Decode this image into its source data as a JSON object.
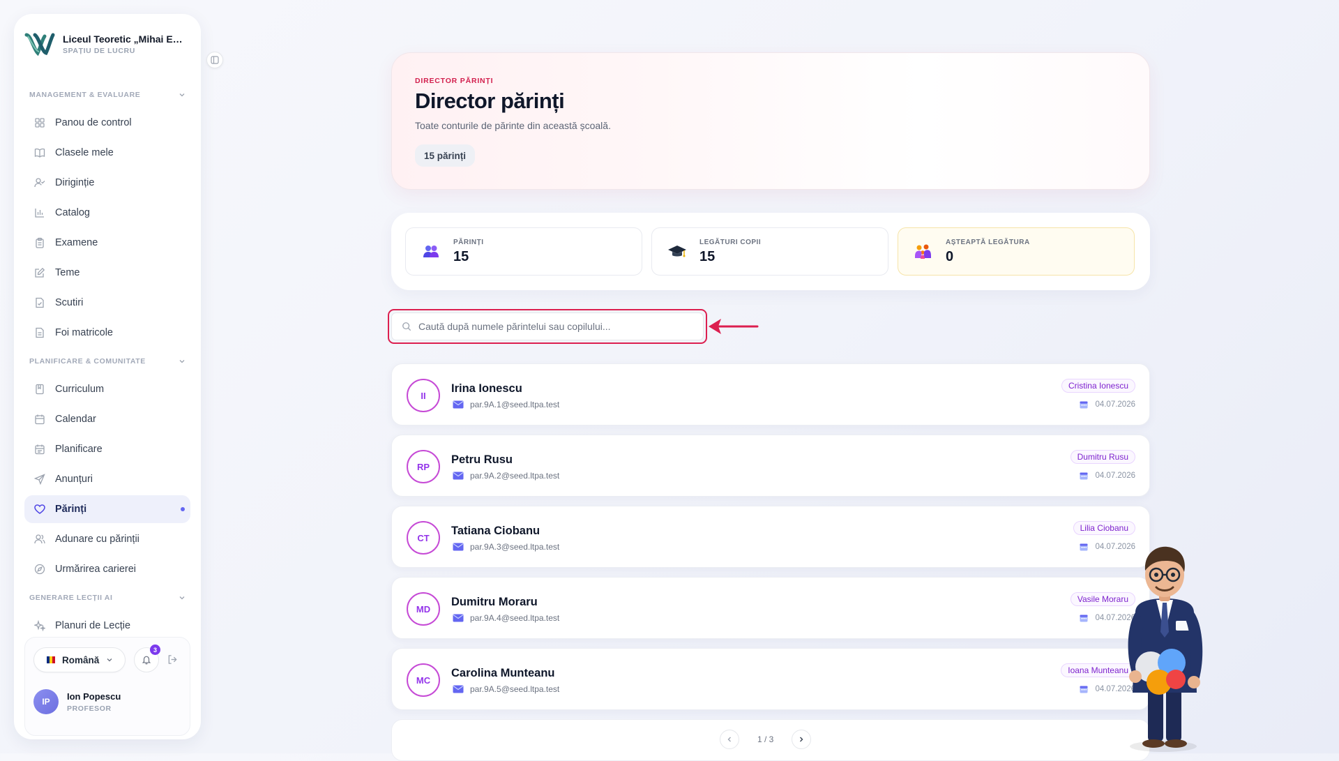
{
  "brand": {
    "name": "Liceul Teoretic „Mihai Eminescu”",
    "subtitle": "SPAȚIU DE LUCRU"
  },
  "sidebar": {
    "sections": [
      {
        "title": "MANAGEMENT & EVALUARE",
        "items": [
          {
            "label": "Panou de control",
            "icon": "grid-icon"
          },
          {
            "label": "Clasele mele",
            "icon": "book-icon"
          },
          {
            "label": "Dirigin​ție",
            "icon": "user-check-icon"
          },
          {
            "label": "Catalog",
            "icon": "bar-chart-icon"
          },
          {
            "label": "Examene",
            "icon": "clipboard-icon"
          },
          {
            "label": "Teme",
            "icon": "edit-icon"
          },
          {
            "label": "Scutiri",
            "icon": "file-check-icon"
          },
          {
            "label": "Foi matricole",
            "icon": "file-text-icon"
          }
        ]
      },
      {
        "title": "PLANIFICARE & COMUNITATE",
        "items": [
          {
            "label": "Curriculum",
            "icon": "bookmark-icon"
          },
          {
            "label": "Calendar",
            "icon": "calendar-icon"
          },
          {
            "label": "Planificare",
            "icon": "calendar-list-icon"
          },
          {
            "label": "Anunțuri",
            "icon": "send-icon"
          },
          {
            "label": "Părinți",
            "icon": "heart-icon",
            "active": true
          },
          {
            "label": "Adunare cu părinții",
            "icon": "users-icon"
          },
          {
            "label": "Urmărirea carierei",
            "icon": "compass-icon"
          }
        ]
      },
      {
        "title": "GENERARE LECȚII AI",
        "items": [
          {
            "label": "Planuri de Lecție",
            "icon": "sparkles-icon"
          }
        ]
      }
    ],
    "footer": {
      "language": "Română",
      "flag_colors": [
        "#002B7F",
        "#FCD116",
        "#CE1126"
      ],
      "notification_count": "3",
      "user_initials": "IP",
      "user_name": "Ion Popescu",
      "user_role": "PROFESOR"
    }
  },
  "hero": {
    "eyebrow": "DIRECTOR PĂRINȚI",
    "title": "Director părinți",
    "description": "Toate conturile de părinte din această școală.",
    "count_chip": "15 părinți"
  },
  "stats": [
    {
      "label": "PĂRINȚI",
      "value": "15",
      "icon": "parents-icon"
    },
    {
      "label": "LEGĂTURI COPII",
      "value": "15",
      "icon": "graduation-cap-icon"
    },
    {
      "label": "AȘTEAPTĂ LEGĂTURA",
      "value": "0",
      "icon": "family-icon"
    }
  ],
  "search": {
    "placeholder": "Caută după numele părintelui sau copilului...",
    "value": ""
  },
  "parents": [
    {
      "initials": "II",
      "name": "Irina Ionescu",
      "email": "par.9A.1@seed.ltpa.test",
      "child": "Cristina Ionescu",
      "date": "04.07.2026"
    },
    {
      "initials": "RP",
      "name": "Petru Rusu",
      "email": "par.9A.2@seed.ltpa.test",
      "child": "Dumitru Rusu",
      "date": "04.07.2026"
    },
    {
      "initials": "CT",
      "name": "Tatiana Ciobanu",
      "email": "par.9A.3@seed.ltpa.test",
      "child": "Lilia Ciobanu",
      "date": "04.07.2026"
    },
    {
      "initials": "MD",
      "name": "Dumitru Moraru",
      "email": "par.9A.4@seed.ltpa.test",
      "child": "Vasile Moraru",
      "date": "04.07.2026"
    },
    {
      "initials": "MC",
      "name": "Carolina Munteanu",
      "email": "par.9A.5@seed.ltpa.test",
      "child": "Ioana Munteanu",
      "date": "04.07.2026"
    }
  ],
  "pagination": {
    "label": "1 / 3"
  },
  "colors": {
    "accent": "#6366f1",
    "brand_red": "#dc1f4f",
    "avatar_ring": "#c64ad6"
  }
}
